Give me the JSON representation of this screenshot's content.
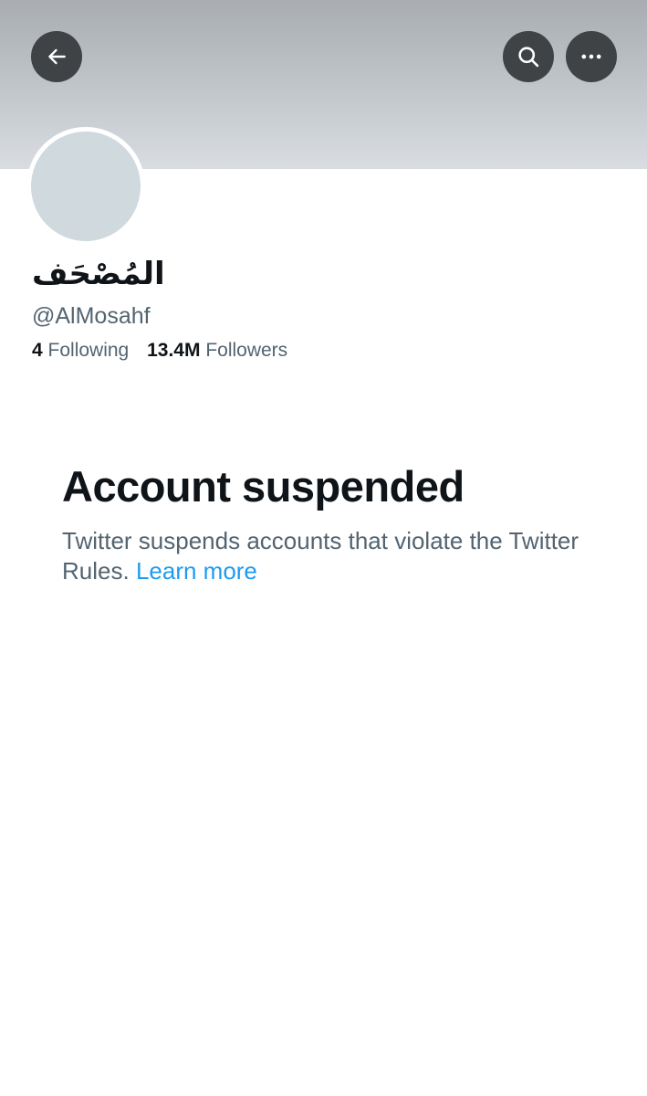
{
  "header": {
    "back_icon": "arrow-left-icon",
    "search_icon": "search-icon",
    "more_icon": "more-horizontal-icon",
    "button_color": "#3f4346"
  },
  "profile": {
    "display_name": "المُصْحَف",
    "handle": "@AlMosahf",
    "following_count": "4",
    "following_label": "Following",
    "followers_count": "13.4M",
    "followers_label": "Followers"
  },
  "suspension": {
    "title": "Account suspended",
    "description": "Twitter suspends accounts that violate the Twitter Rules.",
    "link_label": "Learn more",
    "link_color": "#1d9bf0"
  }
}
